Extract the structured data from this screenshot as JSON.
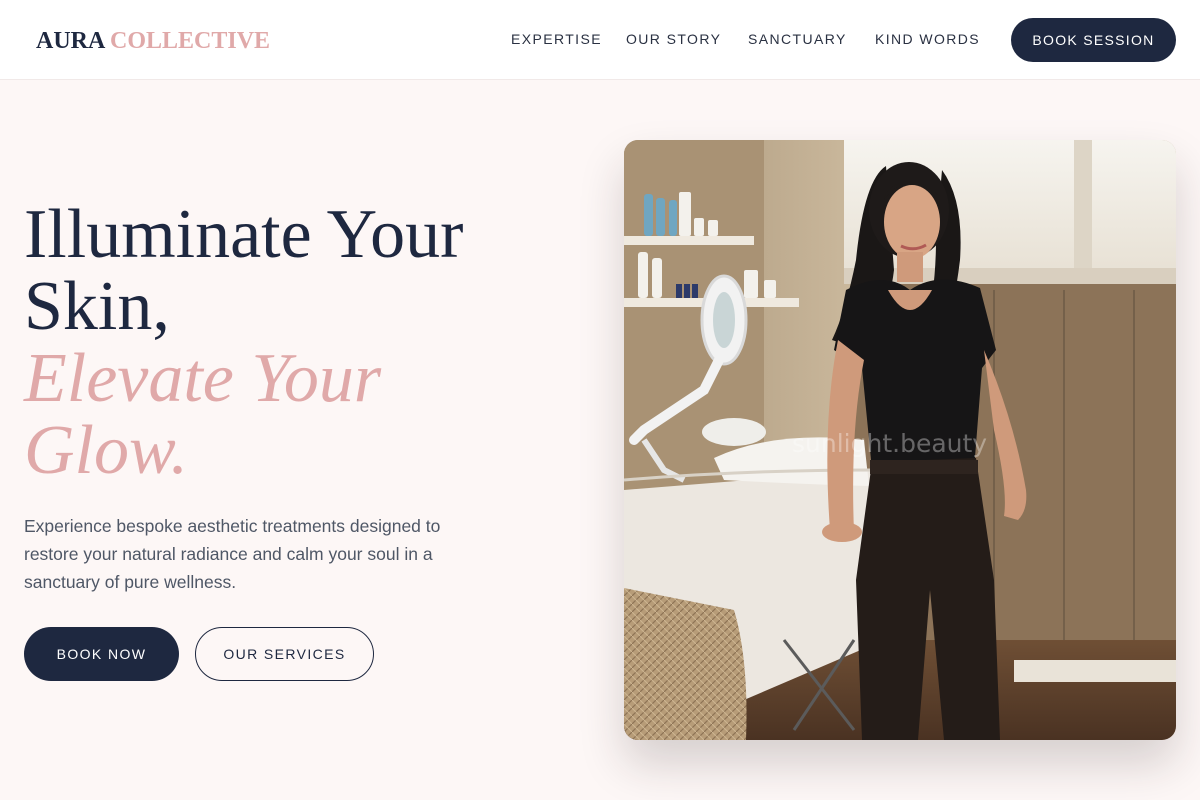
{
  "header": {
    "logo_part1": "AURA",
    "logo_part2": "COLLECTIVE",
    "nav": [
      "EXPERTISE",
      "OUR STORY",
      "SANCTUARY",
      "KIND WORDS"
    ],
    "cta_label": "BOOK SESSION"
  },
  "hero": {
    "headline_line1": "Illuminate Your",
    "headline_line2": "Skin,",
    "headline_accent1": "Elevate Your",
    "headline_accent2": "Glow.",
    "description": "Experience bespoke aesthetic treatments designed to restore your natural radiance and calm your soul in a sanctuary of pure wellness.",
    "primary_button": "BOOK NOW",
    "secondary_button": "OUR SERVICES"
  },
  "photo": {
    "watermark": "sunlight.beauty"
  },
  "colors": {
    "navy": "#1e2840",
    "blush": "#e0a9a9",
    "background": "#fdf7f6"
  }
}
